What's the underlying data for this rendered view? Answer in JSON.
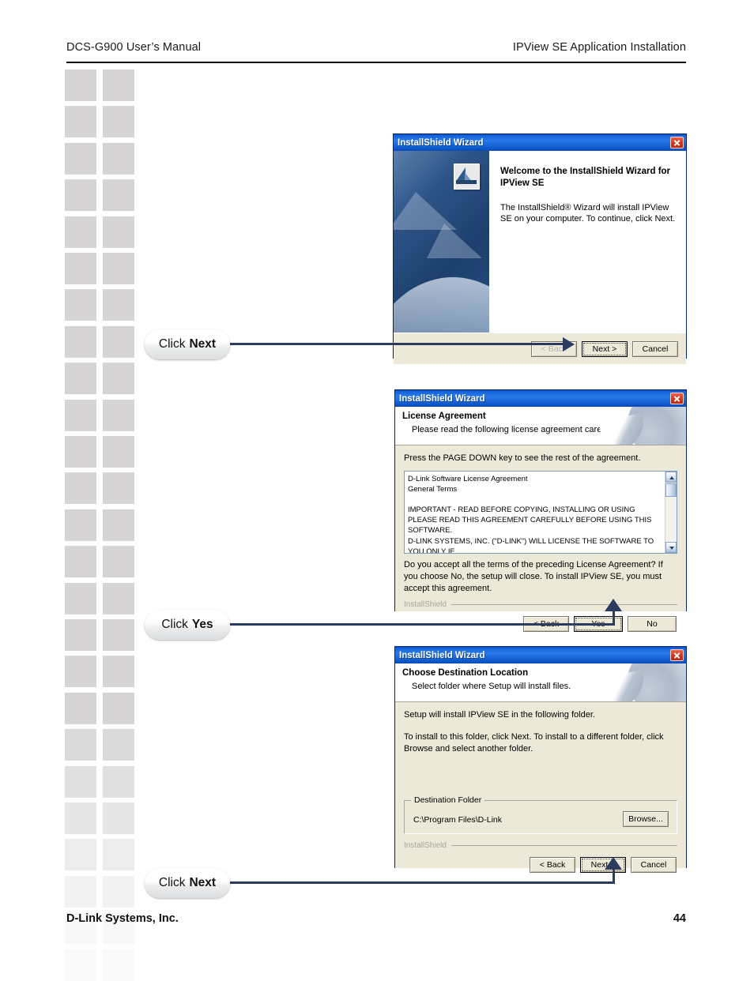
{
  "page": {
    "header_left": "DCS-G900 User’s Manual",
    "header_right": "IPView SE Application Installation",
    "footer_left": "D-Link Systems, Inc.",
    "footer_page": "44"
  },
  "colors": {
    "titlebar_blue": "#1565de",
    "close_red": "#d83b22",
    "dialog_face": "#ece9d8",
    "callout_line": "#2b3c5e",
    "deco_square": "#d6d4d4"
  },
  "callouts": [
    {
      "prefix": "Click",
      "bold": "Next"
    },
    {
      "prefix": "Click",
      "bold": "Yes"
    },
    {
      "prefix": "Click",
      "bold": "Next"
    }
  ],
  "dialog_welcome": {
    "title": "InstallShield Wizard",
    "heading": "Welcome to the InstallShield Wizard for IPView SE",
    "body": "The InstallShield® Wizard will install IPView SE on your computer.  To continue, click Next.",
    "buttons": {
      "back": "< Back",
      "next": "Next >",
      "cancel": "Cancel"
    }
  },
  "dialog_license": {
    "title": "InstallShield Wizard",
    "heading": "License Agreement",
    "subheading": "Please read the following license agreement carefully.",
    "instruction": "Press the PAGE DOWN key to see the rest of the agreement.",
    "license_text": "D-Link Software License Agreement\nGeneral Terms\n\nIMPORTANT - READ BEFORE COPYING, INSTALLING OR USING\nPLEASE READ THIS AGREEMENT CAREFULLY BEFORE USING THIS SOFTWARE.\nD-LINK SYSTEMS, INC. (\"D-LINK\") WILL LICENSE THE SOFTWARE TO YOU ONLY IF\nYOU FIRST ACCEPT THE TERMS OF THIS AGREEMENT. BY INSTALLING AND/OR\nUSING THE SOFTWARE YOU AGREE TO THESE TERMS. IF YOU DO NOT AGREE\nTO THE TERMS OF THIS AGREEMENT, PROMPTLY RETURN THE UNUSED\nSOFTWARE TO THE PARTY (D-LINK OR ITS AUTHORIZED RESELLER) FROM",
    "prompt": "Do you accept all the terms of the preceding License Agreement?  If you choose No, the setup will close.  To install IPView SE, you must accept this agreement.",
    "installshield_label": "InstallShield",
    "buttons": {
      "back": "< Back",
      "yes": "Yes",
      "no": "No"
    }
  },
  "dialog_destination": {
    "title": "InstallShield Wizard",
    "heading": "Choose Destination Location",
    "subheading": "Select folder where Setup will install files.",
    "line1": "Setup will install IPView SE in the following folder.",
    "line2": "To install to this folder, click Next. To install to a different folder, click Browse and select another folder.",
    "group_title": "Destination Folder",
    "path": "C:\\Program Files\\D-Link",
    "browse": "Browse...",
    "installshield_label": "InstallShield",
    "buttons": {
      "back": "< Back",
      "next": "Next >",
      "cancel": "Cancel"
    }
  }
}
